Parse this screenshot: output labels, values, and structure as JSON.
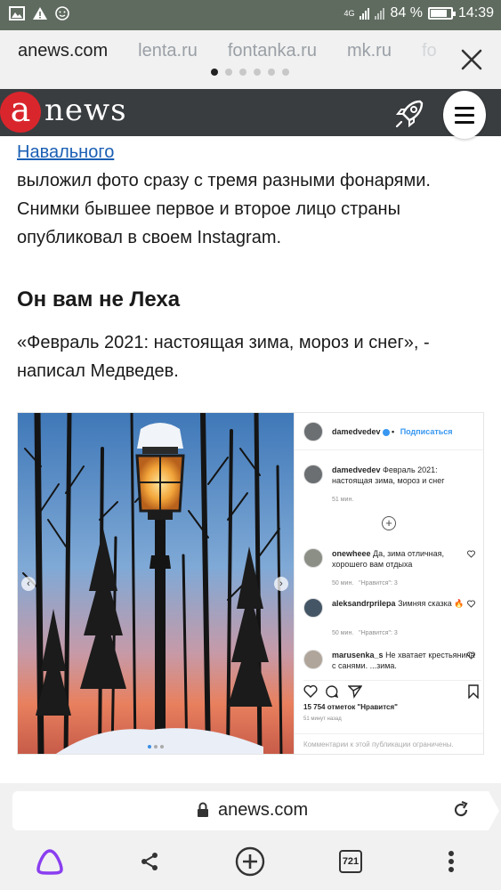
{
  "status_bar": {
    "network": "4G",
    "battery": "84 %",
    "battery_level": 0.84,
    "time": "14:39",
    "icons": [
      "gallery-icon",
      "warning-icon",
      "smiley-icon"
    ]
  },
  "browser_tabs": {
    "tabs": [
      "anews.com",
      "lenta.ru",
      "fontanka.ru",
      "mk.ru",
      "fo"
    ],
    "active_index": 0,
    "page_dots": 6,
    "close_icon": "close-icon"
  },
  "site": {
    "logo_letter": "a",
    "logo_text": "news",
    "brand_color": "#d9262c",
    "header_color": "#3a3d40"
  },
  "article": {
    "link_text": "Навального",
    "paragraph": "выложил фото сразу с тремя разными фонарями. Снимки бывшее первое и второе лицо страны опубликовал в своем Instagram.",
    "heading": "Он вам не Леха",
    "quote": "«Февраль 2021: настоящая зима, мороз и снег», - написал Медведев."
  },
  "instagram": {
    "username": "damedvedev",
    "follow_label": "Подписаться",
    "caption_user": "damedvedev",
    "caption_text": "Февраль 2021: настоящая зима, мороз и снег",
    "caption_time": "51 мин.",
    "comments": [
      {
        "user": "onewheee",
        "text": "Да, зима отличная, хорошего вам отдыха",
        "time": "50 мин.",
        "likes": "\"Нравится\": 3"
      },
      {
        "user": "aleksandrprilepa",
        "text": "Зимняя сказка 🔥",
        "time": "50 мин.",
        "likes": "\"Нравится\": 3"
      },
      {
        "user": "marusenka_s",
        "text": "Не хватает крестьянина с санями. ...зима.",
        "time": "",
        "likes": ""
      }
    ],
    "likes_count": "15 754 отметок \"Нравится\"",
    "post_time": "51 минут назад",
    "footer": "Комментарии к этой публикации ограничены."
  },
  "bottom_bar": {
    "url": "anews.com",
    "tabs_count": "721",
    "toolbar_icons": [
      "alice-icon",
      "share-icon",
      "add-tab-icon",
      "tabs-count-icon",
      "more-icon"
    ]
  }
}
